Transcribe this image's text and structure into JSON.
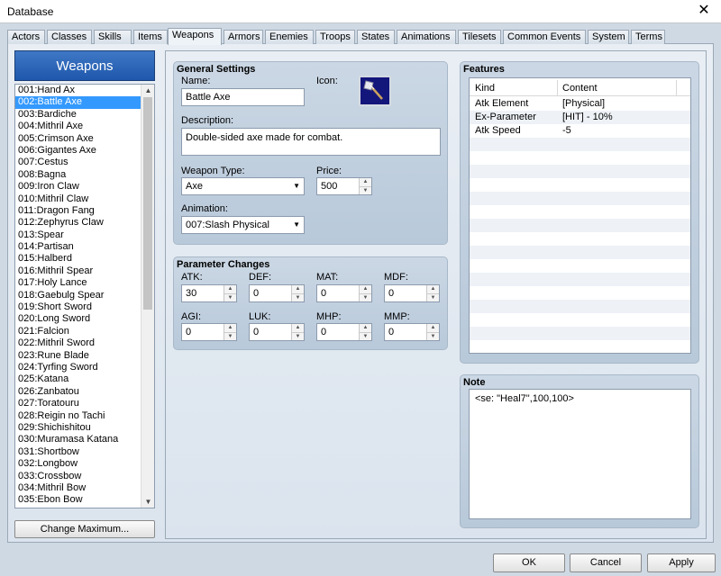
{
  "window": {
    "title": "Database",
    "close_glyph": "✕"
  },
  "tabs": [
    "Actors",
    "Classes",
    "Skills",
    "Items",
    "Weapons",
    "Armors",
    "Enemies",
    "Troops",
    "States",
    "Animations",
    "Tilesets",
    "Common Events",
    "System",
    "Terms"
  ],
  "active_tab": "Weapons",
  "list": {
    "header": "Weapons",
    "selected_index": 1,
    "items": [
      "001:Hand Ax",
      "002:Battle Axe",
      "003:Bardiche",
      "004:Mithril Axe",
      "005:Crimson Axe",
      "006:Gigantes Axe",
      "007:Cestus",
      "008:Bagna",
      "009:Iron Claw",
      "010:Mithril Claw",
      "011:Dragon Fang",
      "012:Zephyrus Claw",
      "013:Spear",
      "014:Partisan",
      "015:Halberd",
      "016:Mithril Spear",
      "017:Holy Lance",
      "018:Gaebulg Spear",
      "019:Short Sword",
      "020:Long Sword",
      "021:Falcion",
      "022:Mithril Sword",
      "023:Rune Blade",
      "024:Tyrfing Sword",
      "025:Katana",
      "026:Zanbatou",
      "027:Toratouru",
      "028:Reigin no Tachi",
      "029:Shichishitou",
      "030:Muramasa Katana",
      "031:Shortbow",
      "032:Longbow",
      "033:Crossbow",
      "034:Mithril Bow",
      "035:Ebon Bow"
    ],
    "change_max_label": "Change Maximum..."
  },
  "general": {
    "title": "General Settings",
    "name_label": "Name:",
    "name_value": "Battle Axe",
    "icon_label": "Icon:",
    "icon": "axe-icon",
    "description_label": "Description:",
    "description_value": "Double-sided axe made for combat.",
    "weapon_type_label": "Weapon Type:",
    "weapon_type_value": "Axe",
    "price_label": "Price:",
    "price_value": "500",
    "animation_label": "Animation:",
    "animation_value": "007:Slash Physical"
  },
  "params": {
    "title": "Parameter Changes",
    "atk": {
      "label": "ATK:",
      "value": "30"
    },
    "def": {
      "label": "DEF:",
      "value": "0"
    },
    "mat": {
      "label": "MAT:",
      "value": "0"
    },
    "mdf": {
      "label": "MDF:",
      "value": "0"
    },
    "agi": {
      "label": "AGI:",
      "value": "0"
    },
    "luk": {
      "label": "LUK:",
      "value": "0"
    },
    "mhp": {
      "label": "MHP:",
      "value": "0"
    },
    "mmp": {
      "label": "MMP:",
      "value": "0"
    }
  },
  "features": {
    "title": "Features",
    "col_kind": "Kind",
    "col_content": "Content",
    "rows": [
      {
        "kind": "Atk Element",
        "content": "[Physical]"
      },
      {
        "kind": "Ex-Parameter",
        "content": "[HIT] - 10%"
      },
      {
        "kind": "Atk Speed",
        "content": "-5"
      }
    ]
  },
  "note": {
    "title": "Note",
    "value": "<se: \"Heal7\",100,100>"
  },
  "buttons": {
    "ok": "OK",
    "cancel": "Cancel",
    "apply": "Apply"
  },
  "colors": {
    "selection": "#3399ff",
    "header_blue": "#1e58ad",
    "icon_bg": "#13167a"
  }
}
